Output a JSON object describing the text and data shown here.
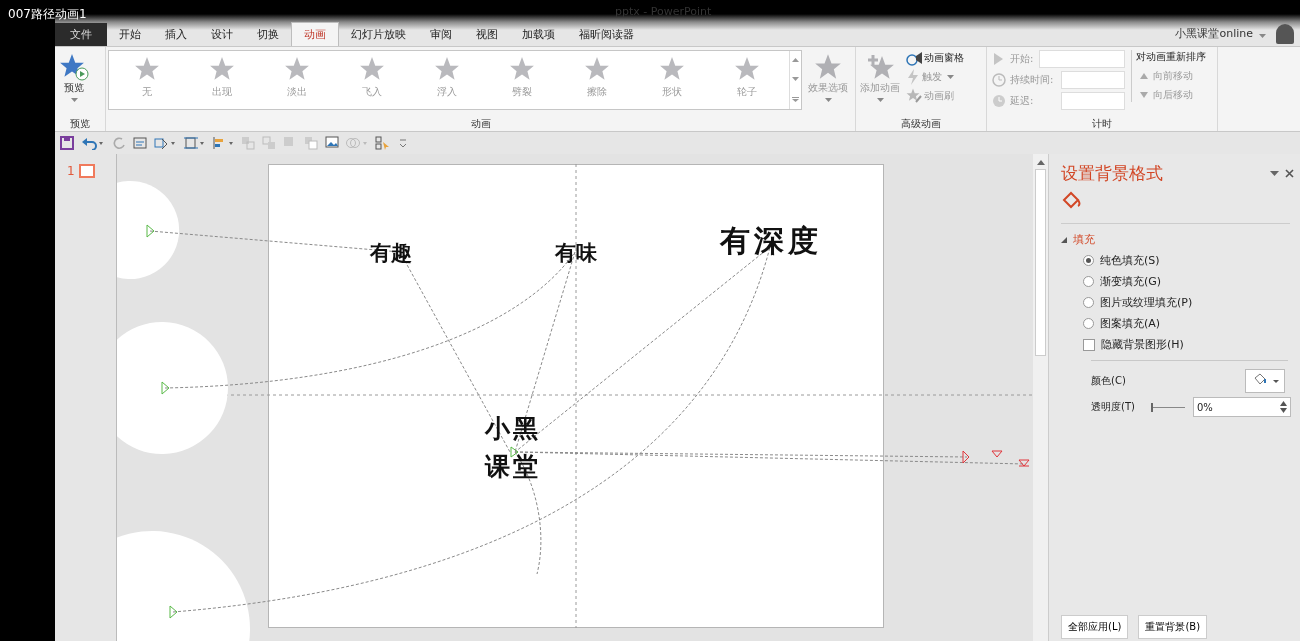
{
  "video_title": "007路径动画1",
  "window": {
    "title": "pptx - PowerPoint",
    "user": "小黑课堂online"
  },
  "tabs": [
    {
      "label": "文件",
      "kind": "file",
      "selected": false
    },
    {
      "label": "开始",
      "kind": "tab",
      "selected": false
    },
    {
      "label": "插入",
      "kind": "tab",
      "selected": false
    },
    {
      "label": "设计",
      "kind": "tab",
      "selected": false
    },
    {
      "label": "切换",
      "kind": "tab",
      "selected": false
    },
    {
      "label": "动画",
      "kind": "tab",
      "selected": true
    },
    {
      "label": "幻灯片放映",
      "kind": "tab",
      "selected": false
    },
    {
      "label": "审阅",
      "kind": "tab",
      "selected": false
    },
    {
      "label": "视图",
      "kind": "tab",
      "selected": false
    },
    {
      "label": "加载项",
      "kind": "tab",
      "selected": false
    },
    {
      "label": "福昕阅读器",
      "kind": "tab",
      "selected": false
    }
  ],
  "ribbon": {
    "preview": {
      "label": "预览",
      "group": "预览"
    },
    "animations": {
      "group": "动画",
      "items": [
        {
          "label": "无"
        },
        {
          "label": "出现"
        },
        {
          "label": "淡出"
        },
        {
          "label": "飞入"
        },
        {
          "label": "浮入"
        },
        {
          "label": "劈裂"
        },
        {
          "label": "擦除"
        },
        {
          "label": "形状"
        },
        {
          "label": "轮子"
        }
      ]
    },
    "effect_options": "效果选项",
    "advanced": {
      "group": "高级动画",
      "add": "添加动画",
      "pane": "动画窗格",
      "trigger": "触发",
      "painter": "动画刷"
    },
    "timing": {
      "group": "计时",
      "start": "开始:",
      "duration": "持续时间:",
      "delay": "延迟:",
      "reorder": "对动画重新排序",
      "forward": "向前移动",
      "backward": "向后移动"
    }
  },
  "slides": [
    {
      "number": "1",
      "selected": true
    }
  ],
  "canvas": {
    "texts": [
      {
        "text": "有趣"
      },
      {
        "text": "有味"
      },
      {
        "text": "有深度"
      },
      {
        "text": "小黑"
      },
      {
        "text": "课堂"
      }
    ]
  },
  "pane": {
    "title": "设置背景格式",
    "section": "填充",
    "expanded": true,
    "options": [
      {
        "label": "纯色填充(S)",
        "selected": true
      },
      {
        "label": "渐变填充(G)",
        "selected": false
      },
      {
        "label": "图片或纹理填充(P)",
        "selected": false
      },
      {
        "label": "图案填充(A)",
        "selected": false
      }
    ],
    "hide_graphics": {
      "label": "隐藏背景图形(H)",
      "checked": false
    },
    "color_label": "颜色(C)",
    "transparency_label": "透明度(T)",
    "transparency": "0%",
    "level": 0,
    "buttons": [
      "全部应用(L)",
      "重置背景(B)"
    ]
  }
}
